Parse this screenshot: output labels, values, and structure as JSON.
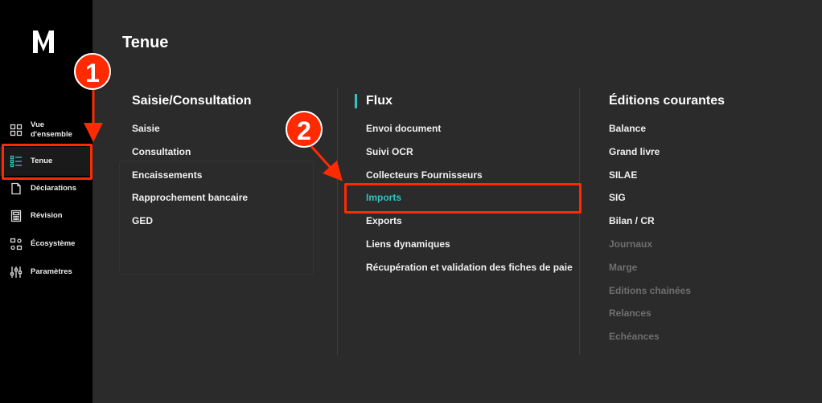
{
  "colors": {
    "accent": "#2ec4c0",
    "highlight": "#ff2a00",
    "sidebar": "#000000",
    "overlay": "#2b2b2b"
  },
  "sidebar": {
    "logo": "M",
    "items": [
      {
        "label": "Vue d'ensemble",
        "icon": "grid-icon"
      },
      {
        "label": "Tenue",
        "icon": "list-icon"
      },
      {
        "label": "Déclarations",
        "icon": "document-icon"
      },
      {
        "label": "Révision",
        "icon": "calculator-icon"
      },
      {
        "label": "Écosystème",
        "icon": "network-icon"
      },
      {
        "label": "Paramètres",
        "icon": "sliders-icon"
      }
    ]
  },
  "menu": {
    "title": "Tenue",
    "columns": [
      {
        "heading": "Saisie/Consultation",
        "items": [
          "Saisie",
          "Consultation",
          "Encaissements",
          "Rapprochement bancaire",
          "GED"
        ]
      },
      {
        "heading": "Flux",
        "items": [
          "Envoi document",
          "Suivi OCR",
          "Collecteurs Fournisseurs",
          "Imports",
          "Exports",
          "Liens dynamiques",
          "Récupération et validation des fiches de paie"
        ]
      },
      {
        "heading": "Éditions courantes",
        "items": [
          "Balance",
          "Grand livre",
          "SILAE",
          "SIG",
          "Bilan / CR",
          "Journaux",
          "Marge",
          "Editions chainées",
          "Relances",
          "Echéances"
        ]
      }
    ]
  },
  "annotations": {
    "step1": "1",
    "step2": "2"
  }
}
